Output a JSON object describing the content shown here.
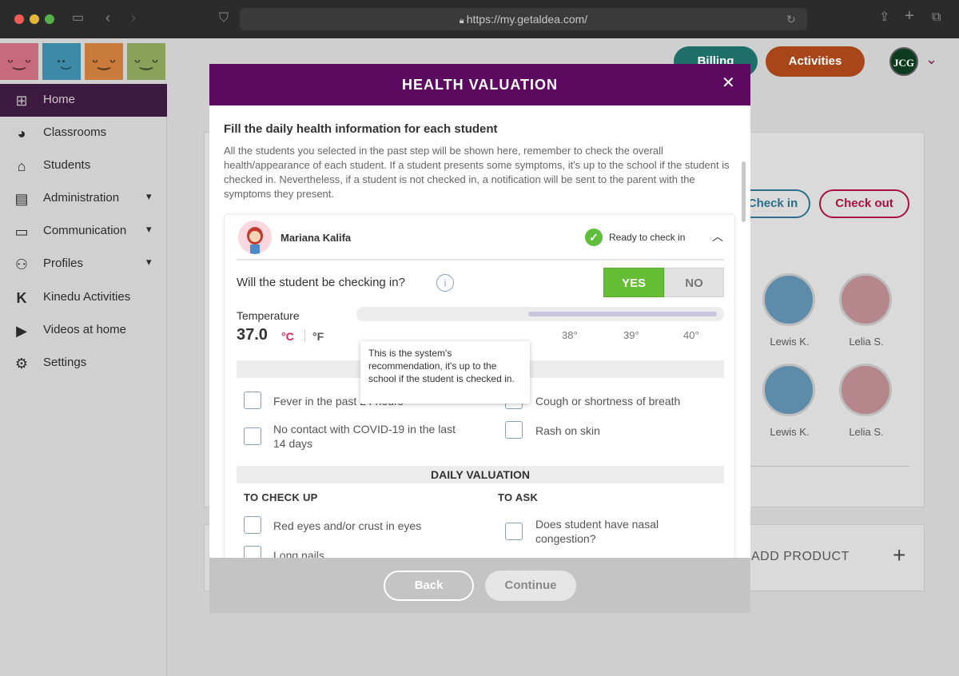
{
  "browser": {
    "url": "https://my.getaldea.com/"
  },
  "header": {
    "billing_label": "Billing",
    "activities_label": "Activities",
    "avatar_initials": "JCG",
    "colors": {
      "billing": "#2a9d96",
      "activities": "#e0531a",
      "brand": "#5c0a60"
    }
  },
  "sidebar": {
    "items": [
      {
        "label": "Home",
        "icon": "layout-icon",
        "active": true
      },
      {
        "label": "Classrooms",
        "icon": "palette-icon"
      },
      {
        "label": "Students",
        "icon": "graduation-cap-icon"
      },
      {
        "label": "Administration",
        "icon": "briefcase-icon",
        "expandable": true
      },
      {
        "label": "Communication",
        "icon": "chat-icon",
        "expandable": true
      },
      {
        "label": "Profiles",
        "icon": "users-icon",
        "expandable": true
      },
      {
        "label": "Kinedu Activities",
        "icon": "kinedu-icon"
      },
      {
        "label": "Videos at home",
        "icon": "youtube-icon"
      },
      {
        "label": "Settings",
        "icon": "gear-icon"
      }
    ]
  },
  "background": {
    "check_in_label": "Check in",
    "check_out_label": "Check out",
    "students": [
      "Lewis K.",
      "Lelia S.",
      "Lewis K.",
      "Lelia S."
    ],
    "add_product_label": "ADD PRODUCT"
  },
  "modal": {
    "title": "HEALTH VALUATION",
    "intro_title": "Fill the daily health information for each student",
    "intro_text": "All the students you selected in the past step will be shown here, remember to check the overall health/appearance of each student. If a student presents some symptoms, it's up to the school if the student is checked in. Nevertheless, if a student is not checked in, a notification will be sent to the parent with the symptoms they present.",
    "student": {
      "name": "Mariana Kalifa",
      "status": "Ready to check in"
    },
    "checkin_question": "Will the student be checking in?",
    "yes_label": "YES",
    "no_label": "NO",
    "temperature": {
      "label": "Temperature",
      "value": "37.0",
      "unit_c": "°C",
      "unit_f": "°F",
      "ticks": [
        "38°",
        "39°",
        "40°"
      ]
    },
    "tooltip": "This is the system's recommendation, it's up to the school if the student is checked in.",
    "covid": {
      "title": "COVID-19 TEST",
      "left": [
        "Fever in the past 24 hours",
        "No contact with COVID-19 in the last 14 days"
      ],
      "right": [
        "Cough or shortness of breath",
        "Rash on skin"
      ]
    },
    "daily": {
      "title": "DAILY VALUATION",
      "check_up_header": "TO CHECK UP",
      "ask_header": "TO ASK",
      "check_up": [
        "Red eyes and/or crust in eyes",
        "Long nails"
      ],
      "ask": [
        "Does student have nasal congestion?"
      ]
    },
    "back_label": "Back",
    "continue_label": "Continue"
  }
}
